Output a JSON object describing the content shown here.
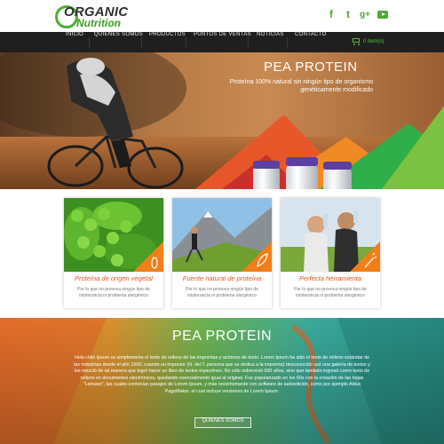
{
  "brand": {
    "line1": "ORGANIC",
    "line2": "Nutrition",
    "green": "#4cae2f"
  },
  "social": [
    {
      "icon": "facebook-icon",
      "glyph": "f"
    },
    {
      "icon": "twitter-icon",
      "glyph": "t"
    },
    {
      "icon": "google-plus-icon",
      "glyph": "g+"
    },
    {
      "icon": "youtube-icon",
      "glyph": ""
    }
  ],
  "nav": {
    "items": [
      "INICIO",
      "QUIENES SOMOS",
      "PRODUCTOS",
      "PUNTOS DE VENTAS",
      "NOTICIAS",
      "CONTACTO"
    ],
    "cart_text": "0 item(s)",
    "cart_icon": "shopping-cart-icon"
  },
  "hero": {
    "title": "PEA PROTEIN",
    "subtitle": "Proteína 100% natural sin ningún tipo de organismo genéticamente modificado"
  },
  "cards": [
    {
      "title": "Proteína de origen vegetal",
      "text": "Por lo que no provoca ningún tipo de intolerancia ni problema alergénico",
      "icon": "peas-icon"
    },
    {
      "title": "Fuente natural de proteína",
      "text": "Por lo que no provoca ningún tipo de intolerancia ni problema alergénico",
      "icon": "leaf-icon"
    },
    {
      "title": "Perfecta herramienta",
      "text": "Por lo que no provoca ningún tipo de intolerancia ni problema alergénico",
      "icon": "carrot-icon"
    }
  ],
  "about": {
    "title": "PEA PROTEIN",
    "text": "Hola chile Ipsum es simplemente el texto de relleno de las imprentas y archivos de texto. Lorem Ipsum ha sido el texto de relleno estándar de las industrias desde el año 1500, cuando un impresor (N. del T. persona que se dedica a la imprenta) desconocido usó una galería de textos y los mezcló de tal manera que logró hacer un libro de textos especimen. No sólo sobrevivió 500 años, sino que también ingresó como texto de relleno en documentos electrónicos, quedando esencialmente igual al original. Fue popularizado en los 60s con la creación de las hojas \"Letraset\", las cuales contenían pasajes de Lorem Ipsum, y más recientemente con software de autoedición, como por ejemplo Aldus PageMaker, el cual incluye versiones de Lorem Ipsum.",
    "button": "QUIENES SOMOS"
  },
  "colors": {
    "accent_orange": "#e6531f",
    "nav_bg": "#1f1f1f",
    "green": "#4cae2f"
  }
}
